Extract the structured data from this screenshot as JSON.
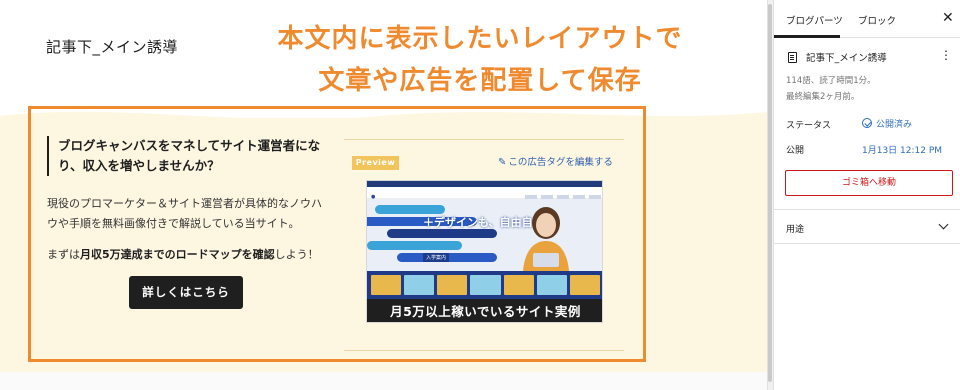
{
  "post": {
    "title": "記事下_メイン誘導"
  },
  "overlay": {
    "line1": "本文内に表示したいレイアウトで",
    "line2": "文章や広告を配置して保存"
  },
  "block": {
    "heading": "ブログキャンバスをマネしてサイト運営者になり、収入を増やしませんか？",
    "description": "現役のプロマーケター＆サイト運営者が具体的なノウハウや手順を無料画像付きで解説している当サイト。",
    "roadmap_prefix": "まずは",
    "roadmap_bold": "月収5万達成までのロードマップを確認",
    "roadmap_suffix": "しよう！",
    "cta_label": "詳しくはこちら",
    "preview_badge": "Preview",
    "edit_tag_label": "この広告タグを編集する",
    "ad_hero_text": "＋デザインも、自由自在。",
    "ad_hero_small": "入学案内",
    "ad_caption": "月5万以上稼いでいるサイト実例"
  },
  "sidebar": {
    "tabs": [
      "ブログパーツ",
      "ブロック"
    ],
    "close_icon": "close-icon",
    "block_name": "記事下_メイン誘導",
    "meta_line1": "114語、読了時間1分。",
    "meta_line2": "最終編集2ヶ月前。",
    "status_label": "ステータス",
    "status_value": "公開済み",
    "publish_label": "公開",
    "publish_value": "1月13日 12:12 PM",
    "trash_label": "ゴミ箱へ移動",
    "usage_label": "用途"
  },
  "colors": {
    "accent_orange": "#ef8a2f",
    "link_blue": "#2f6dbb",
    "danger_red": "#cc1818",
    "cream_bg": "#fdf6e1"
  }
}
